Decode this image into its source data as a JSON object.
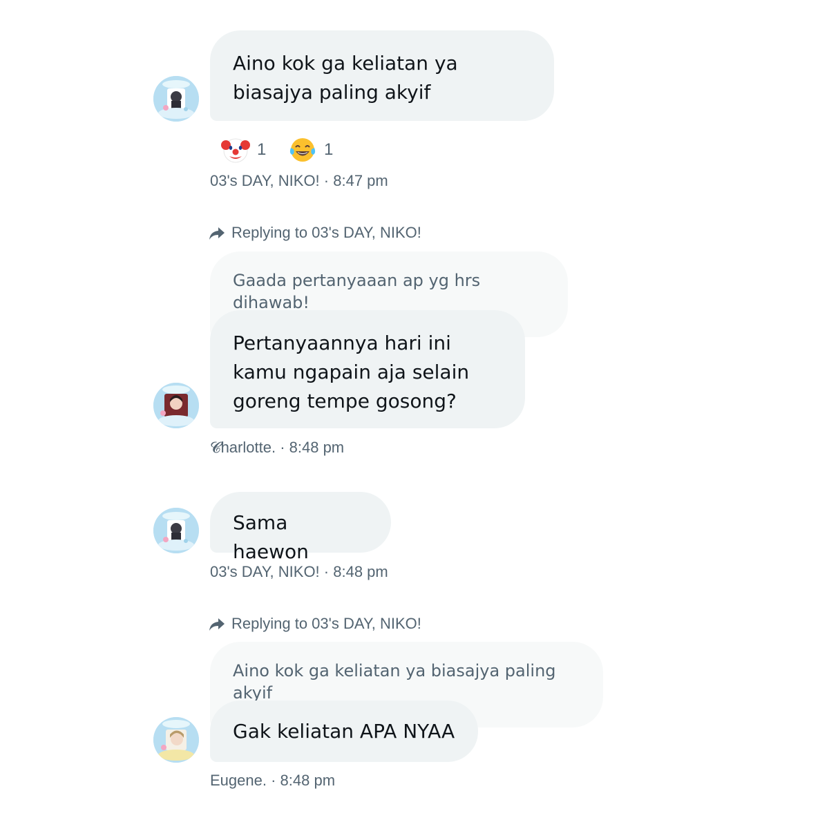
{
  "messages": [
    {
      "text": "Aino kok ga keliatan ya biasajya paling akyif",
      "reactions": [
        {
          "emoji": "clown-face-emoji",
          "count": "1"
        },
        {
          "emoji": "tears-of-joy-emoji",
          "count": "1"
        }
      ],
      "sender": "03's DAY, NIKO!",
      "time": "8:47 pm"
    },
    {
      "reply_label": "Replying to 03's DAY, NIKO!",
      "quoted_text": "Gaada pertanyaaan ap yg hrs dihawab!",
      "text": "Pertanyaannya hari ini kamu ngapain aja selain goreng tempe gosong?",
      "sender": "𝓒harlotte.",
      "time": "8:48 pm"
    },
    {
      "text": "Sama haewon",
      "sender": "03's DAY, NIKO!",
      "time": "8:48 pm"
    },
    {
      "reply_label": "Replying to 03's DAY, NIKO!",
      "quoted_text": "Aino kok ga keliatan ya biasajya paling akyif",
      "text": "Gak keliatan APA NYAA",
      "sender": "Eugene.",
      "time": "8:48 pm"
    }
  ],
  "separator": " · ",
  "colors": {
    "bubble_bg": "#eff3f4",
    "quote_bg": "#f7f9f9",
    "text": "#0f1419",
    "meta_text": "#536471"
  }
}
